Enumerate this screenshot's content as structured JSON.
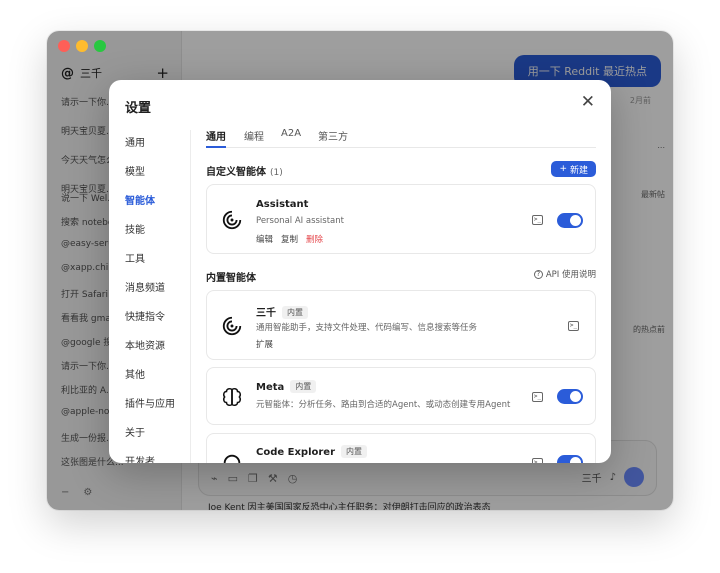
{
  "app": {
    "sidebar": {
      "workspace": "三千",
      "history": [
        "请示一下你...",
        "明天宝贝夏...",
        "今天天气怎么...",
        "明天宝贝夏...",
        "说一下 Wel...",
        "搜索 notebo...",
        "@easy-seruu...",
        "@xapp.chin...",
        "打开 Safari ...",
        "看看我 gmai...",
        "@google 搜...",
        "请示一下你...",
        "利比亚的 A...",
        "@apple-not...",
        "生成一份报...",
        "这张图是什么..."
      ]
    },
    "chat": {
      "user_bubble": "用一下 Reddit 最近热点",
      "timestamp": "2月前",
      "fragments": [
        "...",
        "最新帖",
        "的热点前"
      ],
      "model": "三千",
      "bottom_snippet": "Joe Kent 因主美国国家反恐中心主任职务：对伊朗打击回应的政治表态"
    }
  },
  "settings": {
    "title": "设置",
    "nav": [
      "通用",
      "模型",
      "智能体",
      "技能",
      "工具",
      "消息频道",
      "快捷指令",
      "本地资源",
      "其他",
      "插件与应用",
      "关于",
      "开发者"
    ],
    "nav_active": "智能体",
    "tabs": [
      "通用",
      "编程",
      "A2A",
      "第三方"
    ],
    "tab_active": "通用",
    "custom": {
      "title": "自定义智能体",
      "count": "(1)",
      "new_button": "新建",
      "agents": [
        {
          "name": "Assistant",
          "desc": "Personal AI assistant",
          "actions": [
            "编辑",
            "复制",
            "删除"
          ],
          "enabled": true
        }
      ]
    },
    "builtin": {
      "title": "内置智能体",
      "api_link": "API 使用说明",
      "badge": "内置",
      "agents": [
        {
          "name": "三千",
          "desc": "通用智能助手，支持文件处理、代码编写、信息搜索等任务",
          "extra": "扩展",
          "icon": "spiral-logo-icon"
        },
        {
          "name": "Meta",
          "desc": "元智能体：分析任务、路由到合适的Agent、或动态创建专用Agent",
          "enabled": true,
          "icon": "brain-icon"
        },
        {
          "name": "Code Explorer",
          "enabled": true,
          "icon": "ring-icon"
        }
      ]
    }
  },
  "colors": {
    "accent": "#2b5cd9",
    "danger": "#e5484d"
  }
}
